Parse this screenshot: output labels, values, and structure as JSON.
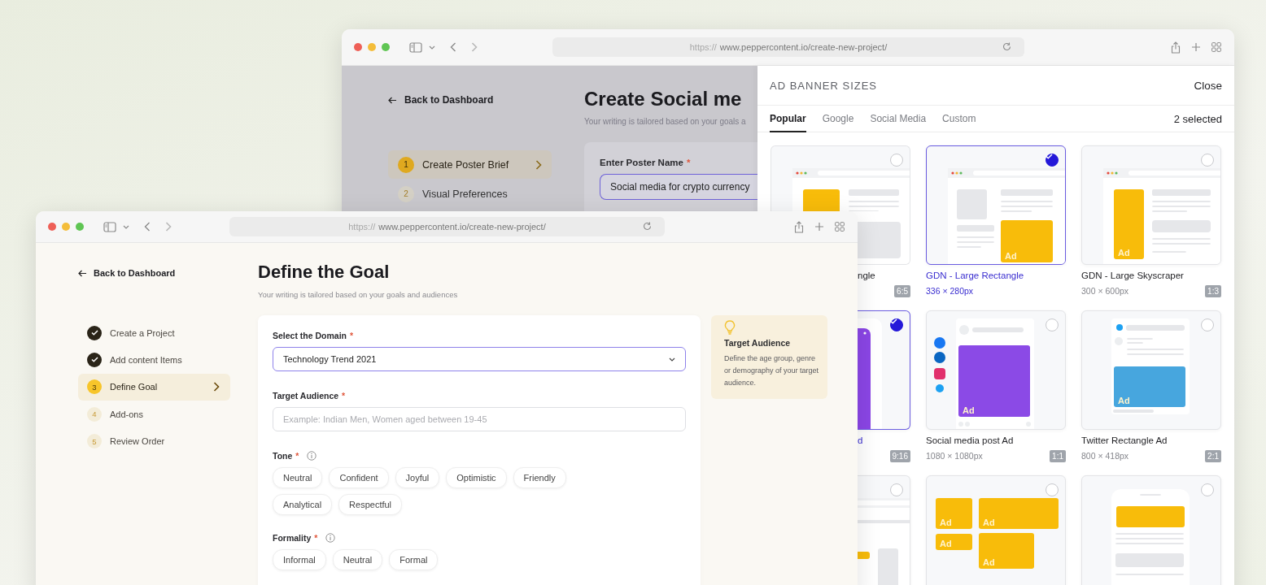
{
  "back_window": {
    "url_scheme": "https://",
    "url_path": "www.peppercontent.io/create-new-project/",
    "back_link": "Back to Dashboard",
    "title": "Create Social me",
    "subtitle": "Your writing is tailored based on your goals a",
    "steps": [
      {
        "number": "1",
        "label": "Create Poster Brief",
        "selected": true
      },
      {
        "number": "2",
        "label": "Visual Preferences",
        "selected": false
      }
    ],
    "field": {
      "label": "Enter Poster Name",
      "required_mark": "*",
      "value": "Social media for crypto currency"
    },
    "modal": {
      "title": "AD BANNER SIZES",
      "close": "Close",
      "selection_count": "2 selected",
      "tabs": [
        {
          "label": "Popular",
          "selected": true
        },
        {
          "label": "Google",
          "selected": false
        },
        {
          "label": "Social Media",
          "selected": false
        },
        {
          "label": "Custom",
          "selected": false
        }
      ],
      "cards": [
        {
          "kind": "rectangle",
          "name": "ngle",
          "ratio": "6:5",
          "selected": false
        },
        {
          "kind": "large_rectangle",
          "name": "GDN - Large Rectangle",
          "size": "336 × 280px",
          "ad_labels": [
            "Ad"
          ],
          "selected": true
        },
        {
          "kind": "skyscraper",
          "name": "GDN - Large Skyscraper",
          "size": "300 × 600px",
          "ratio": "1:3",
          "ad_labels": [
            "Ad"
          ],
          "selected": false
        },
        {
          "kind": "story",
          "name": "d",
          "ratio": "9:16",
          "selected": true
        },
        {
          "kind": "social",
          "name": "Social media post Ad",
          "size": "1080 × 1080px",
          "ratio": "1:1",
          "ad_labels": [
            "Ad"
          ],
          "selected": false
        },
        {
          "kind": "twitter",
          "name": "Twitter Rectangle Ad",
          "size": "800 × 418px",
          "ratio": "2:1",
          "ad_labels": [
            "Ad"
          ],
          "selected": false
        },
        {
          "kind": "leaderboard",
          "selected": false
        },
        {
          "kind": "multi",
          "ad_labels": [
            "Ad",
            "Ad",
            "Ad",
            "Ad"
          ],
          "selected": false
        },
        {
          "kind": "mobile",
          "selected": false
        }
      ]
    }
  },
  "front_window": {
    "url_scheme": "https://",
    "url_path": "www.peppercontent.io/create-new-project/",
    "back_link": "Back to Dashboard",
    "title": "Define the Goal",
    "subtitle": "Your writing is tailored based on your goals and audiences",
    "steps": [
      {
        "label": "Create a Project",
        "completed": true,
        "selected": false
      },
      {
        "label": "Add content Items",
        "completed": true,
        "selected": false
      },
      {
        "number": "3",
        "label": "Define Goal",
        "completed": false,
        "selected": true
      },
      {
        "number": "4",
        "label": "Add-ons",
        "completed": false,
        "selected": false
      },
      {
        "number": "5",
        "label": "Review Order",
        "completed": false,
        "selected": false
      }
    ],
    "domain": {
      "label": "Select the Domain",
      "required_mark": "*",
      "value": "Technology Trend 2021"
    },
    "audience": {
      "label": "Target Audience",
      "required_mark": "*",
      "placeholder": "Example: Indian Men, Women aged between 19-45"
    },
    "tone": {
      "label": "Tone",
      "required_mark": "*",
      "options": [
        "Neutral",
        "Confident",
        "Joyful",
        "Optimistic",
        "Friendly",
        "Analytical",
        "Respectful"
      ]
    },
    "formality": {
      "label": "Formality",
      "required_mark": "*",
      "options": [
        "Informal",
        "Neutral",
        "Formal"
      ]
    },
    "tip": {
      "title": "Target Audience",
      "text": "Define the age group, genre or demography of your target audience."
    }
  }
}
